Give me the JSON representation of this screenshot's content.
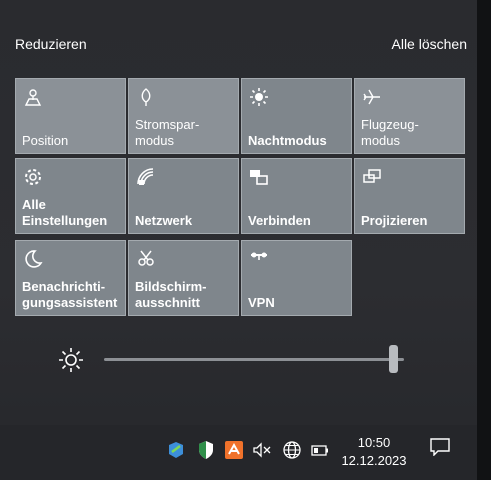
{
  "header": {
    "collapse_label": "Reduzieren",
    "clear_all_label": "Alle löschen"
  },
  "tiles": [
    {
      "label": "Position",
      "icon": "location-icon"
    },
    {
      "label": "Stromspar-\nmodus",
      "icon": "battery-saver-icon"
    },
    {
      "label": "Nachtmodus",
      "icon": "night-light-icon"
    },
    {
      "label": "Flugzeug-\nmodus",
      "icon": "airplane-icon"
    },
    {
      "label": "Alle\nEinstellungen",
      "icon": "gear-icon"
    },
    {
      "label": "Netzwerk",
      "icon": "network-icon"
    },
    {
      "label": "Verbinden",
      "icon": "connect-icon"
    },
    {
      "label": "Projizieren",
      "icon": "project-icon"
    },
    {
      "label": "Benachrichti-\ngungsassistent",
      "icon": "moon-icon"
    },
    {
      "label": "Bildschirm-\nausschnitt",
      "icon": "snip-icon"
    },
    {
      "label": "VPN",
      "icon": "vpn-icon"
    }
  ],
  "brightness": {
    "level": 0.98
  },
  "taskbar": {
    "time": "10:50",
    "date": "12.12.2023"
  },
  "colors": {
    "tile": "#8b9197",
    "background": "#2a2b2f",
    "accent_orange": "#f0722b"
  }
}
